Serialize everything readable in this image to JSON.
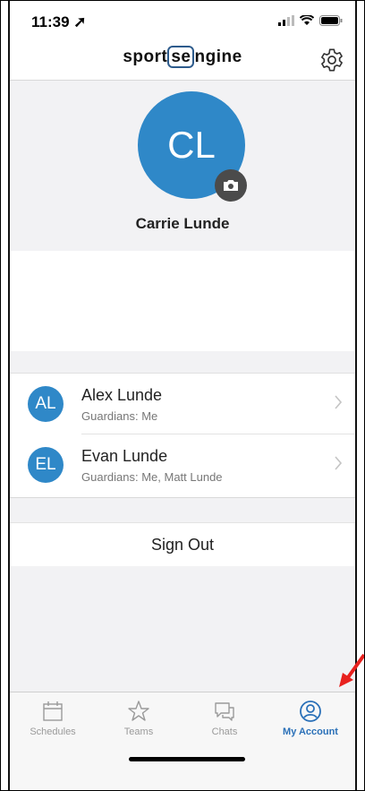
{
  "status_bar": {
    "time": "11:39"
  },
  "nav": {
    "logo_left": "sport",
    "logo_mid": "se",
    "logo_right": "ngine",
    "settings_icon": "gear-icon"
  },
  "profile": {
    "initials": "CL",
    "name": "Carrie Lunde",
    "camera_icon": "camera-icon"
  },
  "members": [
    {
      "initials": "AL",
      "name": "Alex Lunde",
      "guardians": "Guardians: Me"
    },
    {
      "initials": "EL",
      "name": "Evan Lunde",
      "guardians": "Guardians: Me, Matt Lunde"
    }
  ],
  "sign_out": "Sign Out",
  "tabs": [
    {
      "label": "Schedules",
      "icon": "calendar-icon",
      "active": false
    },
    {
      "label": "Teams",
      "icon": "star-icon",
      "active": false
    },
    {
      "label": "Chats",
      "icon": "chat-icon",
      "active": false
    },
    {
      "label": "My Account",
      "icon": "account-icon",
      "active": true
    }
  ],
  "colors": {
    "accent": "#2f88c8",
    "active_tab": "#2a70b8",
    "annotation_arrow": "#e8211e"
  }
}
